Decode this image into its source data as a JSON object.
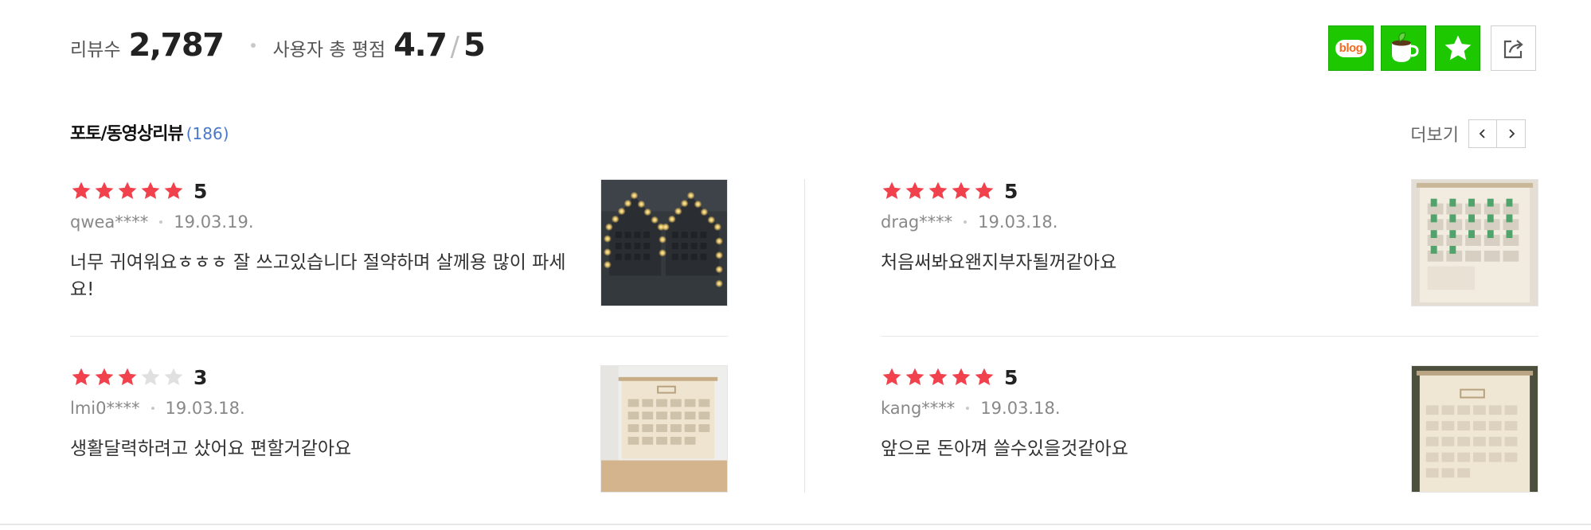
{
  "summary": {
    "review_count_label": "리뷰수",
    "review_count": "2,787",
    "rating_label": "사용자 총 평점",
    "rating": "4.7",
    "rating_sep": "/",
    "rating_max": "5"
  },
  "share_buttons": [
    "blog",
    "cafe",
    "favorite",
    "share"
  ],
  "share": {
    "blog_label": "blog"
  },
  "photo_reviews": {
    "title": "포토/동영상리뷰",
    "count": "(186)",
    "more_label": "더보기"
  },
  "colors": {
    "star_on": "#f0414d",
    "star_off": "#e0e0e0",
    "share_green": "#1ec800",
    "count_blue": "#4a78c8"
  },
  "reviews": [
    {
      "rating": 5,
      "score": "5",
      "user": "qwea****",
      "date": "19.03.19.",
      "text": "너무 귀여워요ㅎㅎㅎ 잘 쓰고있습니다 절약하며 살께용 많이 파세요!"
    },
    {
      "rating": 5,
      "score": "5",
      "user": "drag****",
      "date": "19.03.18.",
      "text": "처음써봐요왠지부자될꺼같아요"
    },
    {
      "rating": 3,
      "score": "3",
      "user": "lmi0****",
      "date": "19.03.18.",
      "text": "생활달력하려고 샀어요 편할거같아요"
    },
    {
      "rating": 5,
      "score": "5",
      "user": "kang****",
      "date": "19.03.18.",
      "text": "앞으로 돈아껴 쓸수있을것같아요"
    }
  ]
}
